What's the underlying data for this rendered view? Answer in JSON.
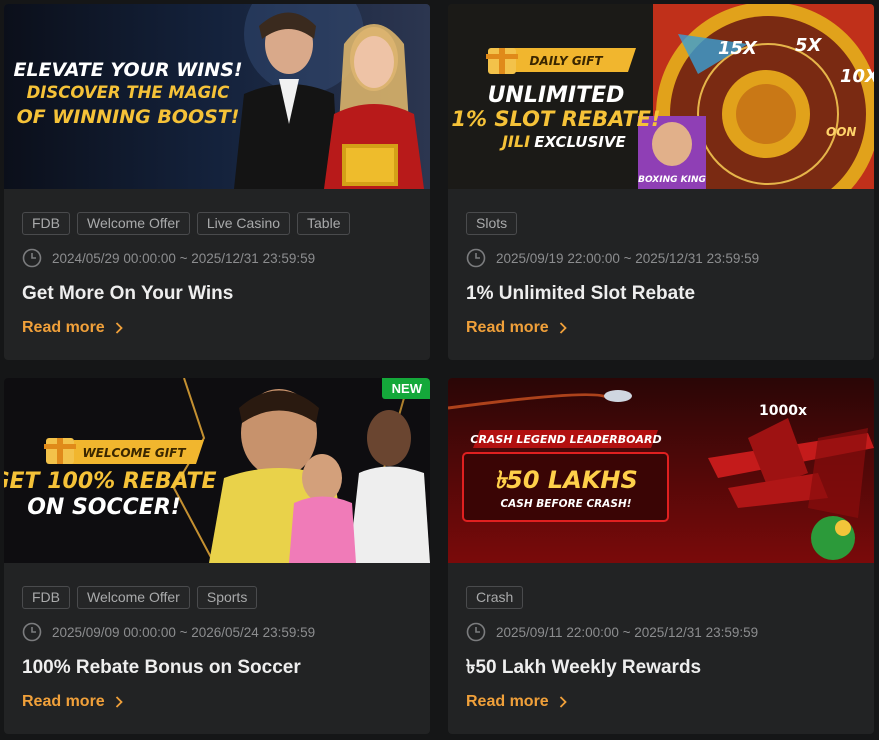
{
  "cards": [
    {
      "banner": {
        "line1": "ELEVATE YOUR WINS!",
        "line2": "DISCOVER THE MAGIC",
        "line3": "OF WINNING BOOST!"
      },
      "tags": [
        "FDB",
        "Welcome Offer",
        "Live Casino",
        "Table"
      ],
      "date": "2024/05/29 00:00:00 ~ 2025/12/31 23:59:59",
      "title": "Get More On Your Wins",
      "read_more": "Read more"
    },
    {
      "banner": {
        "ribbon": "DAILY GIFT",
        "line1": "UNLIMITED",
        "line2": "1% SLOT REBATE!",
        "brand": "JILI",
        "brand_suffix": "EXCLUSIVE",
        "game_label": "BOXING KING",
        "wheel_15x": "15X",
        "wheel_5x": "5X",
        "wheel_10x": "10X",
        "wheel_oon": "OON"
      },
      "tags": [
        "Slots"
      ],
      "date": "2025/09/19 22:00:00 ~ 2025/12/31 23:59:59",
      "title": "1% Unlimited Slot Rebate",
      "read_more": "Read more"
    },
    {
      "banner": {
        "ribbon": "WELCOME GIFT",
        "line1": "GET 100% REBATE",
        "line2": "ON SOCCER!",
        "badge": "NEW"
      },
      "tags": [
        "FDB",
        "Welcome Offer",
        "Sports"
      ],
      "date": "2025/09/09 00:00:00 ~ 2026/05/24 23:59:59",
      "title": "100% Rebate Bonus on Soccer",
      "read_more": "Read more"
    },
    {
      "banner": {
        "ribbon": "CRASH LEGEND LEADERBOARD",
        "line1": "৳50 LAKHS",
        "line2": "CASH BEFORE CRASH!",
        "multiplier": "1000x"
      },
      "tags": [
        "Crash"
      ],
      "date": "2025/09/11 22:00:00 ~ 2025/12/31 23:59:59",
      "title": "৳50 Lakh Weekly Rewards",
      "read_more": "Read more"
    }
  ],
  "colors": {
    "accent": "#f0a03a",
    "card_bg": "#222324",
    "page_bg": "#151617",
    "new_badge": "#14a83a"
  },
  "icons": [
    "clock-icon",
    "chevron-right-icon",
    "gift-icon"
  ]
}
